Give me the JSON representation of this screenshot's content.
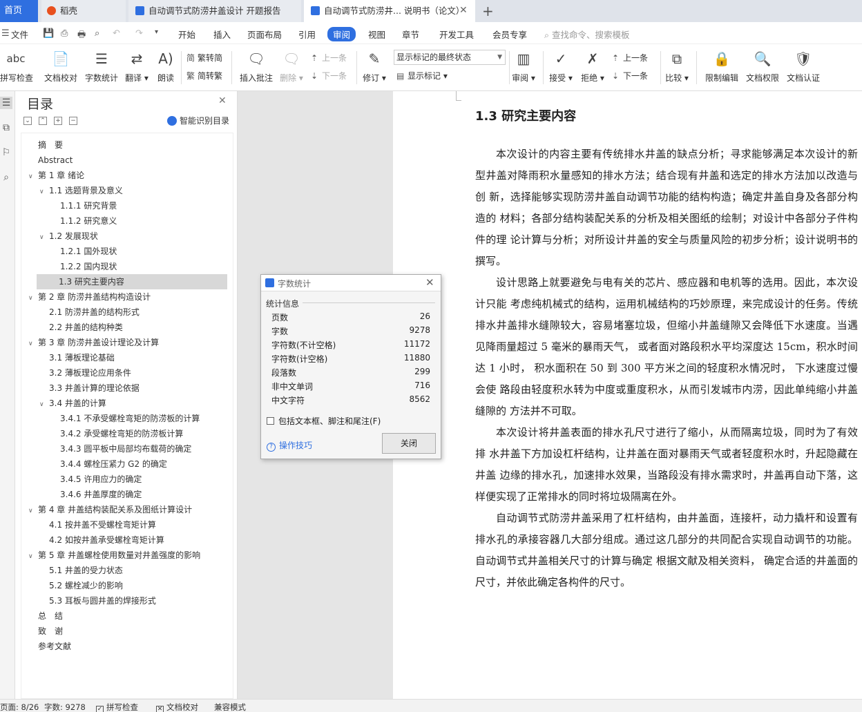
{
  "tabs": {
    "home": "首页",
    "docer": "稻壳",
    "doc1": "自动调节式防涝井盖设计 开题报告",
    "doc2": "自动调节式防涝井... 说明书（论文）"
  },
  "menu": {
    "file": "文件",
    "items": [
      "开始",
      "插入",
      "页面布局",
      "引用",
      "审阅",
      "视图",
      "章节",
      "开发工具",
      "会员专享"
    ],
    "search_placeholder": "查找命令、搜索模板"
  },
  "ribbon": {
    "spell": "拼写检查",
    "doc_proof": "文档校对",
    "word_count": "字数统计",
    "translate": "翻译",
    "read_aloud": "朗读",
    "trad_to_simp": "繁转简",
    "simp_to_trad": "简转繁",
    "insert_comment": "插入批注",
    "delete": "删除",
    "prev": "上一条",
    "next": "下一条",
    "revise": "修订",
    "show_markup_select": "显示标记的最终状态",
    "show_markup": "显示标记",
    "review": "审阅",
    "accept": "接受",
    "reject": "拒绝",
    "prev2": "上一条",
    "next2": "下一条",
    "compare": "比较",
    "restrict_edit": "限制编辑",
    "doc_permission": "文档权限",
    "doc_auth": "文档认证"
  },
  "toc": {
    "title": "目录",
    "smart": "智能识别目录",
    "items": [
      {
        "label": "摘　要",
        "level": 0,
        "chev": false
      },
      {
        "label": "Abstract",
        "level": 0,
        "chev": false
      },
      {
        "label": "第 1 章  绪论",
        "level": 0,
        "chev": true
      },
      {
        "label": "1.1 选题背景及意义",
        "level": 1,
        "chev": true
      },
      {
        "label": "1.1.1 研究背景",
        "level": 2,
        "chev": false
      },
      {
        "label": "1.1.2 研究意义",
        "level": 2,
        "chev": false
      },
      {
        "label": "1.2 发展现状",
        "level": 1,
        "chev": true
      },
      {
        "label": "1.2.1 国外现状",
        "level": 2,
        "chev": false
      },
      {
        "label": "1.2.2 国内现状",
        "level": 2,
        "chev": false
      },
      {
        "label": "1.3 研究主要内容",
        "level": 1,
        "chev": false,
        "selected": true
      },
      {
        "label": "第 2 章  防涝井盖结构构造设计",
        "level": 0,
        "chev": true
      },
      {
        "label": "2.1 防涝井盖的结构形式",
        "level": 1,
        "chev": false
      },
      {
        "label": "2.2 井盖的结构种类",
        "level": 1,
        "chev": false
      },
      {
        "label": "第 3 章  防涝井盖设计理论及计算",
        "level": 0,
        "chev": true
      },
      {
        "label": "3.1 薄板理论基础",
        "level": 1,
        "chev": false
      },
      {
        "label": "3.2 薄板理论应用条件",
        "level": 1,
        "chev": false
      },
      {
        "label": "3.3 井盖计算的理论依据",
        "level": 1,
        "chev": false
      },
      {
        "label": "3.4 井盖的计算",
        "level": 1,
        "chev": true
      },
      {
        "label": "3.4.1 不承受螺栓弯矩的防涝板的计算",
        "level": 2,
        "chev": false
      },
      {
        "label": "3.4.2 承受螺栓弯矩的防涝板计算",
        "level": 2,
        "chev": false
      },
      {
        "label": "3.4.3 圆平板中局部均布载荷的确定",
        "level": 2,
        "chev": false
      },
      {
        "label": "3.4.4 螺栓压紧力 G2 的确定",
        "level": 2,
        "chev": false
      },
      {
        "label": "3.4.5  许用应力的确定",
        "level": 2,
        "chev": false
      },
      {
        "label": "3.4.6  井盖厚度的确定",
        "level": 2,
        "chev": false
      },
      {
        "label": "第 4 章  井盖结构装配关系及图纸计算设计",
        "level": 0,
        "chev": true
      },
      {
        "label": "4.1 按井盖不受螺栓弯矩计算",
        "level": 1,
        "chev": false
      },
      {
        "label": "4.2 如按井盖承受螺栓弯矩计算",
        "level": 1,
        "chev": false
      },
      {
        "label": "第 5 章  井盖螺栓使用数量对井盖强度的影响",
        "level": 0,
        "chev": true
      },
      {
        "label": "5.1 井盖的受力状态",
        "level": 1,
        "chev": false
      },
      {
        "label": "5.2 螺栓减少的影响",
        "level": 1,
        "chev": false
      },
      {
        "label": "5.3 耳板与圆井盖的焊接形式",
        "level": 1,
        "chev": false
      },
      {
        "label": "总　结",
        "level": 0,
        "chev": false
      },
      {
        "label": "致　谢",
        "level": 0,
        "chev": false
      },
      {
        "label": "参考文献",
        "level": 0,
        "chev": false
      }
    ]
  },
  "doc": {
    "heading": "1.3 研究主要内容",
    "paragraphs": [
      "本次设计的内容主要有传统排水井盖的缺点分析；寻求能够满足本次设计的新型井盖对降雨积水量感知的排水方法；结合现有井盖和选定的排水方法加以改造与创 新，选择能够实现防涝井盖自动调节功能的结构构造；确定井盖自身及各部分构造的 材料；各部分结构装配关系的分析及相关图纸的绘制；对设计中各部分子件构件的理 论计算与分析；对所设计井盖的安全与质量风险的初步分析；设计说明书的撰写。",
      "设计思路上就要避免与电有关的芯片、感应器和电机等的选用。因此，本次设计只能 考虑纯机械式的结构，运用机械结构的巧妙原理，来完成设计的任务。传统排水井盖排水缝隙较大，容易堵塞垃圾，但缩小井盖缝隙又会降低下水速度。当遇见降雨量超过 5 毫米的暴雨天气， 或者面对路段积水平均深度达 15cm，积水时间达 1 小时， 积水面积在 50 到 300 平方米之间的轻度积水情况时， 下水速度过慢会使 路段由轻度积水转为中度或重度积水，从而引发城市内涝，因此单纯缩小井盖缝隙的 方法并不可取。",
      "本次设计将井盖表面的排水孔尺寸进行了缩小，从而隔离垃圾，同时为了有效排 水井盖下方加设杠杆结构，让井盖在面对暴雨天气或者轻度积水时，升起隐藏在井盖 边缘的排水孔，加速排水效果，当路段没有排水需求时，井盖再自动下落，这样便实现了正常排水的同时将垃圾隔离在外。",
      "自动调节式防涝井盖采用了杠杆结构，由井盖面，连接杆，动力撬杆和设置有排水孔的承接容器几大部分组成。通过这几部分的共同配合实现自动调节的功能。自动调节式井盖相关尺寸的计算与确定 根据文献及相关资料， 确定合适的井盖面的尺寸，并依此确定各构件的尺寸。"
    ]
  },
  "dialog": {
    "title": "字数统计",
    "section": "统计信息",
    "stats": [
      {
        "label": "页数",
        "value": "26"
      },
      {
        "label": "字数",
        "value": "9278"
      },
      {
        "label": "字符数(不计空格)",
        "value": "11172"
      },
      {
        "label": "字符数(计空格)",
        "value": "11880"
      },
      {
        "label": "段落数",
        "value": "299"
      },
      {
        "label": "非中文单词",
        "value": "716"
      },
      {
        "label": "中文字符",
        "value": "8562"
      }
    ],
    "checkbox": "包括文本框、脚注和尾注(F)",
    "tips": "操作技巧",
    "close": "关闭"
  },
  "status": {
    "page": "页面: 8/26",
    "words": "字数: 9278",
    "spell": "拼写检查",
    "proof": "文档校对",
    "compat": "兼容模式"
  },
  "colors": {
    "accent": "#2f6fe0"
  }
}
